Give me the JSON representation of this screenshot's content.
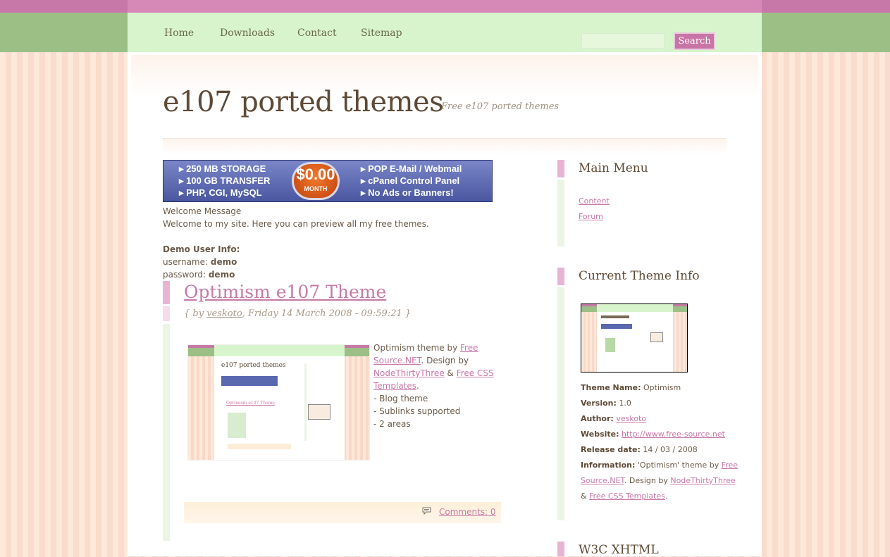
{
  "nav": {
    "items": [
      "Home",
      "Downloads",
      "Contact",
      "Sitemap"
    ],
    "search_button": "Search"
  },
  "site": {
    "title": "e107 ported themes",
    "slogan": "Free e107 ported themes"
  },
  "banner": {
    "left": [
      "250 MB STORAGE",
      "100 GB TRANSFER",
      "PHP, CGI, MySQL"
    ],
    "price": "$0.00",
    "price_unit": "MONTH",
    "right": [
      "POP E-Mail / Webmail",
      "cPanel Control Panel",
      "No Ads or Banners!"
    ]
  },
  "welcome": {
    "heading": "Welcome Message",
    "text": "Welcome to my site. Here you can preview all my free themes.",
    "demo_heading": "Demo User Info:",
    "username_label": "username:",
    "username": "demo",
    "password_label": "password:",
    "password": "demo"
  },
  "post": {
    "title": "Optimism e107 Theme",
    "meta_prefix": "{ by ",
    "author": "veskoto",
    "meta_date": ", Friday 14 March 2008 - 09:59:21 }",
    "body_line1_text": "Optimism theme by ",
    "body_link1a": "Free",
    "body_link1b": "Source.NET",
    "body_line2_text": ". Design by",
    "body_link2": "NodeThirtyThree",
    "body_amp": " & ",
    "body_link3a": "Free CSS",
    "body_link3b": "Templates",
    "body_period": ".",
    "features": [
      "- Blog theme",
      "- Sublinks supported",
      "- 2 areas"
    ],
    "comments": "Comments: 0"
  },
  "thumb_mini": {
    "title": "e107 ported themes",
    "post_title": "Optimism e107 Theme"
  },
  "sidebar": {
    "main_menu": {
      "title": "Main Menu",
      "links": [
        "Content",
        "Forum"
      ]
    },
    "theme_info": {
      "title": "Current Theme Info",
      "theme_name_label": "Theme Name:",
      "theme_name": "Optimism",
      "version_label": "Version:",
      "version": "1.0",
      "author_label": "Author:",
      "author": "veskoto",
      "website_label": "Website:",
      "website": "http://www.free-source.net",
      "release_label": "Release date:",
      "release": "14 / 03 / 2008",
      "information_label": "Information:",
      "info_text1": "'Optimism' theme by ",
      "info_link1a": "Free",
      "info_link1b": "Source.NET",
      "info_text2": ". Design by ",
      "info_link2": "NodeThirtyThree",
      "info_amp": "& ",
      "info_link3": "Free CSS Templates",
      "info_period": "."
    },
    "w3c": {
      "title": "W3C XHTML"
    }
  },
  "colors": {
    "pink_accent": "#c878a8",
    "nav_green": "#d8f4cc",
    "band_green": "#9cbf86",
    "band_pink": "#d689b6"
  }
}
